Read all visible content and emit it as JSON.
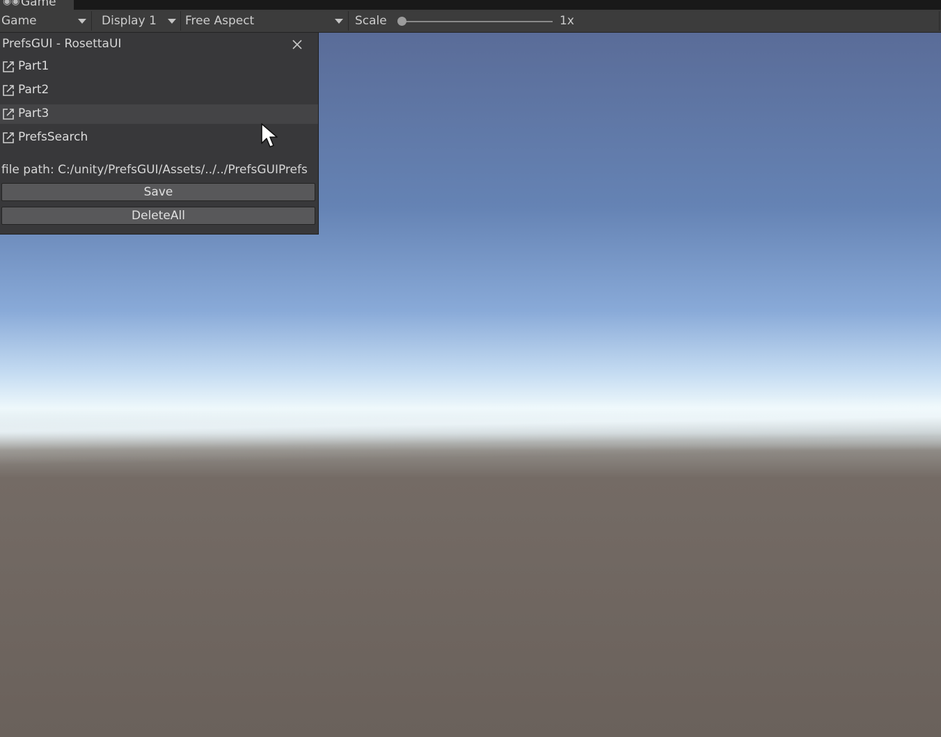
{
  "tab": {
    "icon": "gamepad-icon",
    "label": "Game"
  },
  "toolbar": {
    "mode": "Game",
    "display": "Display 1",
    "aspect": "Free Aspect",
    "scale_label": "Scale",
    "scale_value": "1x",
    "scale_slider_fraction": 0.0
  },
  "panel": {
    "title": "PrefsGUI - RosettaUI",
    "items": [
      {
        "label": "Part1",
        "icon": "external-window-icon"
      },
      {
        "label": "Part2",
        "icon": "external-window-icon"
      },
      {
        "label": "Part3",
        "icon": "external-window-icon",
        "highlighted": true
      },
      {
        "label": "PrefsSearch",
        "icon": "external-window-icon"
      }
    ],
    "file_path": "file path: C:/unity/PrefsGUI/Assets/../../PrefsGUIPrefs",
    "save_label": "Save",
    "delete_all_label": "DeleteAll"
  },
  "colors": {
    "panel_bg": "#38383a",
    "toolbar_bg": "#3c3c3c",
    "sky_top": "#5a6c98",
    "ground": "#6a615b"
  }
}
